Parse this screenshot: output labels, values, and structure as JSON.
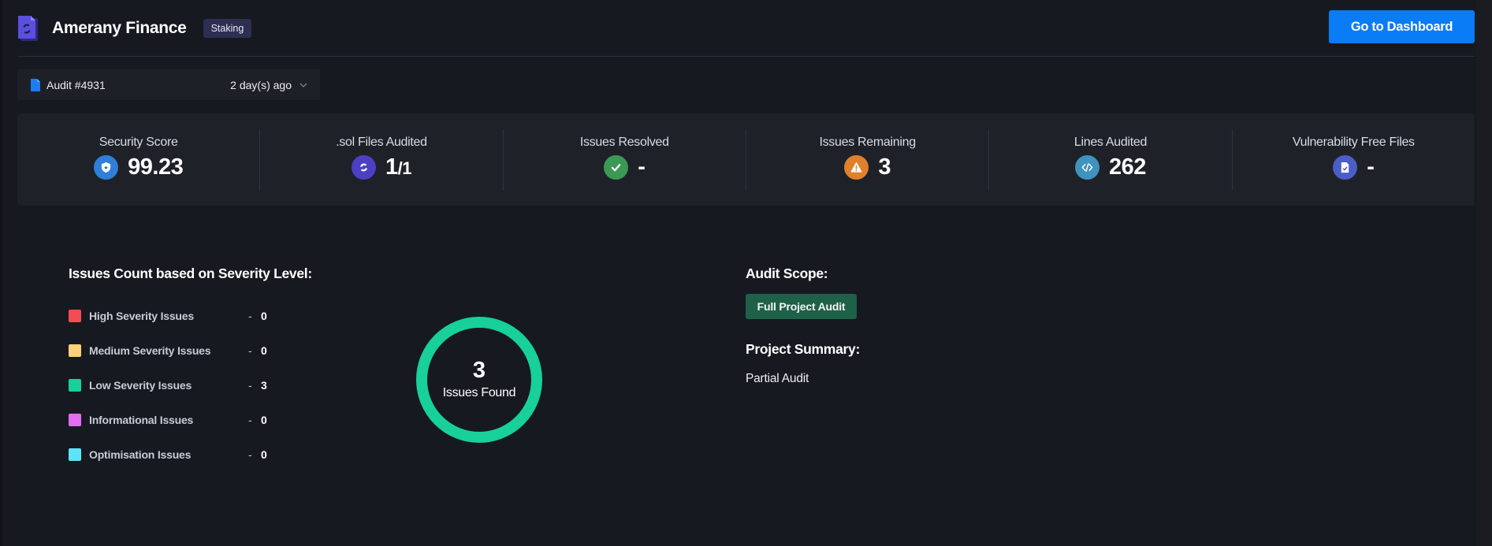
{
  "header": {
    "brand_name": "Amerany Finance",
    "tag": "Staking",
    "dashboard_button": "Go to Dashboard",
    "accent_color": "#0a7cf6"
  },
  "audit_select": {
    "label": "Audit #4931",
    "time": "2 day(s) ago"
  },
  "stats": [
    {
      "label": "Security Score",
      "value": "99.23",
      "icon": "shield-icon",
      "color": "#2f7fd8"
    },
    {
      "label": ".sol Files Audited",
      "value": "1",
      "value_suffix": "/1",
      "icon": "swap-icon",
      "color": "#4b40c4"
    },
    {
      "label": "Issues Resolved",
      "value": "-",
      "icon": "check-icon",
      "color": "#3a9a55"
    },
    {
      "label": "Issues Remaining",
      "value": "3",
      "icon": "warning-icon",
      "color": "#e0802b"
    },
    {
      "label": "Lines Audited",
      "value": "262",
      "icon": "code-icon",
      "color": "#3f93bd"
    },
    {
      "label": "Vulnerability Free Files",
      "value": "-",
      "icon": "file-check-icon",
      "color": "#4a5ec6"
    }
  ],
  "severity": {
    "title": "Issues Count based on Severity Level:",
    "items": [
      {
        "label": "High Severity Issues",
        "count": "0",
        "color": "#f04e50"
      },
      {
        "label": "Medium Severity Issues",
        "count": "0",
        "color": "#fdd07a"
      },
      {
        "label": "Low Severity Issues",
        "count": "3",
        "color": "#17d09a"
      },
      {
        "label": "Informational Issues",
        "count": "0",
        "color": "#e16ef0"
      },
      {
        "label": "Optimisation Issues",
        "count": "0",
        "color": "#5ee2f6"
      }
    ],
    "separator": "-"
  },
  "donut": {
    "count": "3",
    "label": "Issues Found",
    "color": "#17d09a"
  },
  "scope": {
    "title": "Audit Scope:",
    "badge": "Full Project Audit",
    "summary_title": "Project Summary:",
    "summary_text": "Partial Audit"
  }
}
